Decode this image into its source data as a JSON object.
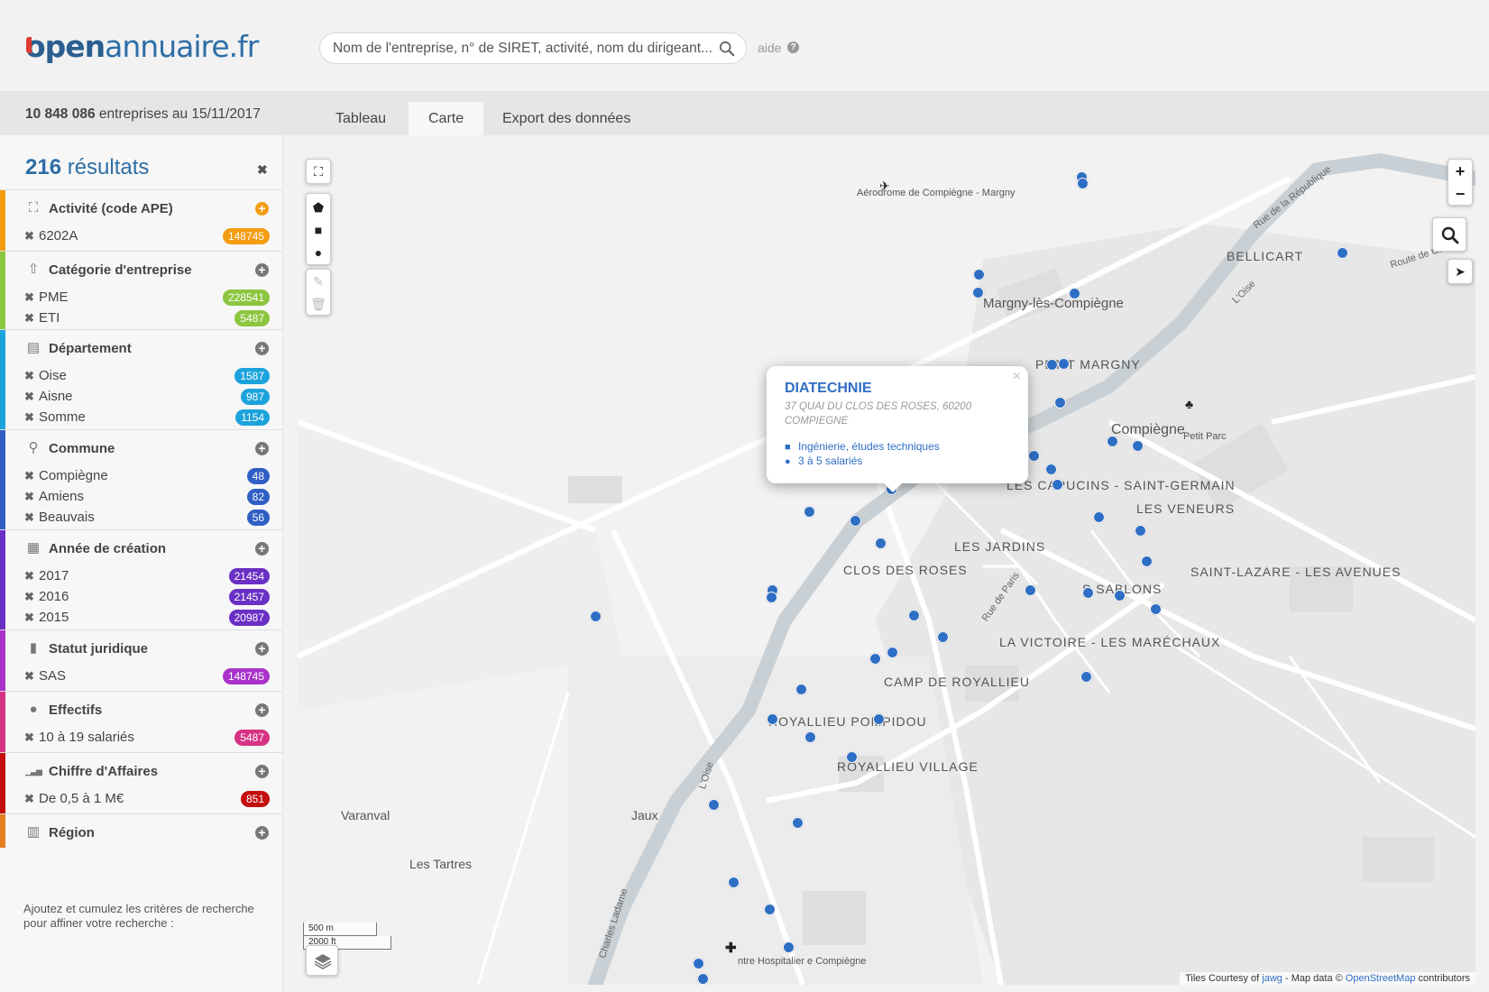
{
  "header": {
    "logo_prefix": "open",
    "logo_suffix": "annuaire.fr",
    "search_placeholder": "Nom de l'entreprise, n° de SIRET, activité, nom du dirigeant...",
    "help_label": "aide",
    "help_icon_glyph": "?"
  },
  "toolbar": {
    "company_count": "10 848 086",
    "count_suffix": "entreprises au 15/11/2017",
    "tabs": [
      {
        "label": "Tableau",
        "active": false
      },
      {
        "label": "Carte",
        "active": true
      },
      {
        "label": "Export des données",
        "active": false
      }
    ]
  },
  "sidebar": {
    "results_count": "216",
    "results_label": "résultats",
    "close_glyph": "✖",
    "hint": "Ajoutez et cumulez les critères de recherche pour affiner votre recherche :",
    "sections": [
      {
        "title": "Activité (code APE)",
        "icon": "sitemap-icon",
        "color": "#f39c12",
        "add_color": "#f39c12",
        "items": [
          {
            "label": "6202A",
            "count": "148745"
          }
        ]
      },
      {
        "title": "Catégorie d'entreprise",
        "icon": "category-icon",
        "color": "#8cc63f",
        "items": [
          {
            "label": "PME",
            "count": "228541"
          },
          {
            "label": "ETI",
            "count": "5487"
          }
        ]
      },
      {
        "title": "Département",
        "icon": "map-icon",
        "color": "#1ca3dc",
        "items": [
          {
            "label": "Oise",
            "count": "1587"
          },
          {
            "label": "Aisne",
            "count": "987"
          },
          {
            "label": "Somme",
            "count": "1154"
          }
        ]
      },
      {
        "title": "Commune",
        "icon": "pin-icon",
        "color": "#2f5fc4",
        "items": [
          {
            "label": "Compiègne",
            "count": "48"
          },
          {
            "label": "Amiens",
            "count": "82"
          },
          {
            "label": "Beauvais",
            "count": "56"
          }
        ]
      },
      {
        "title": "Année de création",
        "icon": "calendar-icon",
        "color": "#6a2fc4",
        "items": [
          {
            "label": "2017",
            "count": "21454"
          },
          {
            "label": "2016",
            "count": "21457"
          },
          {
            "label": "2015",
            "count": "20987"
          }
        ]
      },
      {
        "title": "Statut juridique",
        "icon": "bookmark-icon",
        "color": "#a933c9",
        "items": [
          {
            "label": "SAS",
            "count": "148745"
          }
        ]
      },
      {
        "title": "Effectifs",
        "icon": "user-icon",
        "color": "#d63384",
        "items": [
          {
            "label": "10 à 19 salariés",
            "count": "5487"
          }
        ]
      },
      {
        "title": "Chiffre d'Affaires",
        "icon": "signal-icon",
        "color": "#c40e0e",
        "items": [
          {
            "label": "De 0,5 à 1 M€",
            "count": "851"
          }
        ]
      },
      {
        "title": "Région",
        "icon": "region-map-icon",
        "color": "#e67e22",
        "items": []
      }
    ]
  },
  "map": {
    "labels": {
      "aerodrome": "Aérodrome de Compiègne - Margny",
      "margny": "Margny-lès-Compiègne",
      "bellicart": "BELLICART",
      "petit_margny": "PETIT MARGNY",
      "compiegne": "Compiègne",
      "petit_parc": "Petit Parc",
      "capucins": "LES CAPUCINS - SAINT-GERMAIN",
      "veneurs": "LES VENEURS",
      "jardins": "LES JARDINS",
      "clos_des_roses": "CLOS DES ROSES",
      "sablons": "S SABLONS",
      "saint_lazare": "SAINT-LAZARE - LES AVENUES",
      "victoire": "LA VICTOIRE - LES MARÉCHAUX",
      "camp_royallieu": "CAMP DE ROYALLIEU",
      "royallieu_pompidou": "ROYALLIEU POMPIDOU",
      "royallieu_village": "ROYALLIEU VILLAGE",
      "varanval": "Varanval",
      "jaux": "Jaux",
      "les_tartres": "Les Tartres",
      "hopital": "ntre Hospitalier e Compiègne",
      "rue_republique": "Rue de la République",
      "route_choisy": "Route de Choisy",
      "rue_paris": "Rue de Paris",
      "loise_1": "L'Oise",
      "loise_2": "L'Oise",
      "charles_lalame": "Charles Ladame"
    },
    "popup": {
      "name": "DIATECHNIE",
      "address": "37 QUAI DU CLOS DES ROSES, 60200 COMPIEGNE",
      "activity": "Ingénierie, études techniques",
      "staff": "3 à 5 salariés"
    },
    "scale": {
      "metric": "500 m",
      "imperial": "2000 ft"
    },
    "attribution": {
      "prefix": "Tiles Courtesy of",
      "jawg": "jawg",
      "middle": "- Map data ©",
      "osm": "OpenStreetMap",
      "suffix": "contributors"
    }
  }
}
